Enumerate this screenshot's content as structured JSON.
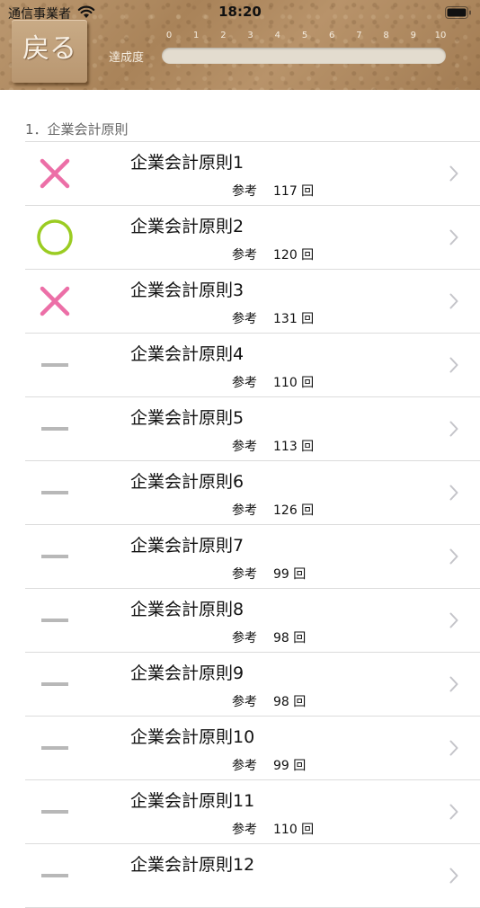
{
  "status_bar": {
    "carrier": "通信事業者",
    "time": "18:20"
  },
  "header": {
    "back_label": "戻る",
    "progress_label": "達成度",
    "scale_ticks": [
      "0",
      "1",
      "2",
      "3",
      "4",
      "5",
      "6",
      "7",
      "8",
      "9",
      "10"
    ],
    "progress_value": 0
  },
  "section": {
    "title": "1．企業会計原則"
  },
  "rows": [
    {
      "title": "企業会計原則1",
      "sub_label": "参考",
      "count": "117 回",
      "status": "wrong"
    },
    {
      "title": "企業会計原則2",
      "sub_label": "参考",
      "count": "120 回",
      "status": "correct"
    },
    {
      "title": "企業会計原則3",
      "sub_label": "参考",
      "count": "131 回",
      "status": "wrong"
    },
    {
      "title": "企業会計原則4",
      "sub_label": "参考",
      "count": "110 回",
      "status": "unanswered"
    },
    {
      "title": "企業会計原則5",
      "sub_label": "参考",
      "count": "113 回",
      "status": "unanswered"
    },
    {
      "title": "企業会計原則6",
      "sub_label": "参考",
      "count": "126 回",
      "status": "unanswered"
    },
    {
      "title": "企業会計原則7",
      "sub_label": "参考",
      "count": "99 回",
      "status": "unanswered"
    },
    {
      "title": "企業会計原則8",
      "sub_label": "参考",
      "count": "98 回",
      "status": "unanswered"
    },
    {
      "title": "企業会計原則9",
      "sub_label": "参考",
      "count": "98 回",
      "status": "unanswered"
    },
    {
      "title": "企業会計原則10",
      "sub_label": "参考",
      "count": "99 回",
      "status": "unanswered"
    },
    {
      "title": "企業会計原則11",
      "sub_label": "参考",
      "count": "110 回",
      "status": "unanswered"
    },
    {
      "title": "企業会計原則12",
      "sub_label": "",
      "count": "",
      "status": "unanswered"
    }
  ],
  "colors": {
    "wrong": "#ec6fa7",
    "correct": "#9bcc22",
    "unanswered": "#b8b8b8",
    "chevron": "#c4c4c9"
  }
}
